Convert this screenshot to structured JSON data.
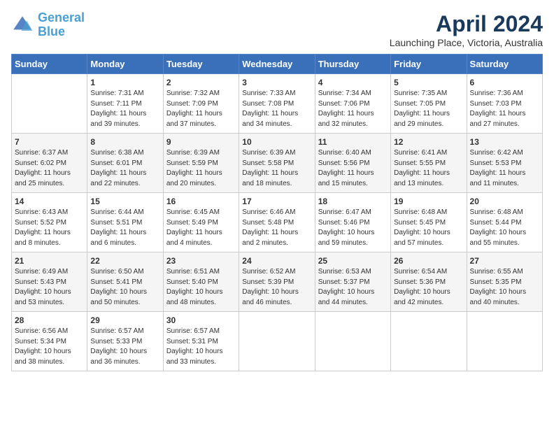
{
  "header": {
    "logo_line1": "General",
    "logo_line2": "Blue",
    "title": "April 2024",
    "subtitle": "Launching Place, Victoria, Australia"
  },
  "days_of_week": [
    "Sunday",
    "Monday",
    "Tuesday",
    "Wednesday",
    "Thursday",
    "Friday",
    "Saturday"
  ],
  "weeks": [
    [
      {
        "day": "",
        "info": ""
      },
      {
        "day": "1",
        "info": "Sunrise: 7:31 AM\nSunset: 7:11 PM\nDaylight: 11 hours\nand 39 minutes."
      },
      {
        "day": "2",
        "info": "Sunrise: 7:32 AM\nSunset: 7:09 PM\nDaylight: 11 hours\nand 37 minutes."
      },
      {
        "day": "3",
        "info": "Sunrise: 7:33 AM\nSunset: 7:08 PM\nDaylight: 11 hours\nand 34 minutes."
      },
      {
        "day": "4",
        "info": "Sunrise: 7:34 AM\nSunset: 7:06 PM\nDaylight: 11 hours\nand 32 minutes."
      },
      {
        "day": "5",
        "info": "Sunrise: 7:35 AM\nSunset: 7:05 PM\nDaylight: 11 hours\nand 29 minutes."
      },
      {
        "day": "6",
        "info": "Sunrise: 7:36 AM\nSunset: 7:03 PM\nDaylight: 11 hours\nand 27 minutes."
      }
    ],
    [
      {
        "day": "7",
        "info": "Sunrise: 6:37 AM\nSunset: 6:02 PM\nDaylight: 11 hours\nand 25 minutes."
      },
      {
        "day": "8",
        "info": "Sunrise: 6:38 AM\nSunset: 6:01 PM\nDaylight: 11 hours\nand 22 minutes."
      },
      {
        "day": "9",
        "info": "Sunrise: 6:39 AM\nSunset: 5:59 PM\nDaylight: 11 hours\nand 20 minutes."
      },
      {
        "day": "10",
        "info": "Sunrise: 6:39 AM\nSunset: 5:58 PM\nDaylight: 11 hours\nand 18 minutes."
      },
      {
        "day": "11",
        "info": "Sunrise: 6:40 AM\nSunset: 5:56 PM\nDaylight: 11 hours\nand 15 minutes."
      },
      {
        "day": "12",
        "info": "Sunrise: 6:41 AM\nSunset: 5:55 PM\nDaylight: 11 hours\nand 13 minutes."
      },
      {
        "day": "13",
        "info": "Sunrise: 6:42 AM\nSunset: 5:53 PM\nDaylight: 11 hours\nand 11 minutes."
      }
    ],
    [
      {
        "day": "14",
        "info": "Sunrise: 6:43 AM\nSunset: 5:52 PM\nDaylight: 11 hours\nand 8 minutes."
      },
      {
        "day": "15",
        "info": "Sunrise: 6:44 AM\nSunset: 5:51 PM\nDaylight: 11 hours\nand 6 minutes."
      },
      {
        "day": "16",
        "info": "Sunrise: 6:45 AM\nSunset: 5:49 PM\nDaylight: 11 hours\nand 4 minutes."
      },
      {
        "day": "17",
        "info": "Sunrise: 6:46 AM\nSunset: 5:48 PM\nDaylight: 11 hours\nand 2 minutes."
      },
      {
        "day": "18",
        "info": "Sunrise: 6:47 AM\nSunset: 5:46 PM\nDaylight: 10 hours\nand 59 minutes."
      },
      {
        "day": "19",
        "info": "Sunrise: 6:48 AM\nSunset: 5:45 PM\nDaylight: 10 hours\nand 57 minutes."
      },
      {
        "day": "20",
        "info": "Sunrise: 6:48 AM\nSunset: 5:44 PM\nDaylight: 10 hours\nand 55 minutes."
      }
    ],
    [
      {
        "day": "21",
        "info": "Sunrise: 6:49 AM\nSunset: 5:43 PM\nDaylight: 10 hours\nand 53 minutes."
      },
      {
        "day": "22",
        "info": "Sunrise: 6:50 AM\nSunset: 5:41 PM\nDaylight: 10 hours\nand 50 minutes."
      },
      {
        "day": "23",
        "info": "Sunrise: 6:51 AM\nSunset: 5:40 PM\nDaylight: 10 hours\nand 48 minutes."
      },
      {
        "day": "24",
        "info": "Sunrise: 6:52 AM\nSunset: 5:39 PM\nDaylight: 10 hours\nand 46 minutes."
      },
      {
        "day": "25",
        "info": "Sunrise: 6:53 AM\nSunset: 5:37 PM\nDaylight: 10 hours\nand 44 minutes."
      },
      {
        "day": "26",
        "info": "Sunrise: 6:54 AM\nSunset: 5:36 PM\nDaylight: 10 hours\nand 42 minutes."
      },
      {
        "day": "27",
        "info": "Sunrise: 6:55 AM\nSunset: 5:35 PM\nDaylight: 10 hours\nand 40 minutes."
      }
    ],
    [
      {
        "day": "28",
        "info": "Sunrise: 6:56 AM\nSunset: 5:34 PM\nDaylight: 10 hours\nand 38 minutes."
      },
      {
        "day": "29",
        "info": "Sunrise: 6:57 AM\nSunset: 5:33 PM\nDaylight: 10 hours\nand 36 minutes."
      },
      {
        "day": "30",
        "info": "Sunrise: 6:57 AM\nSunset: 5:31 PM\nDaylight: 10 hours\nand 33 minutes."
      },
      {
        "day": "",
        "info": ""
      },
      {
        "day": "",
        "info": ""
      },
      {
        "day": "",
        "info": ""
      },
      {
        "day": "",
        "info": ""
      }
    ]
  ]
}
